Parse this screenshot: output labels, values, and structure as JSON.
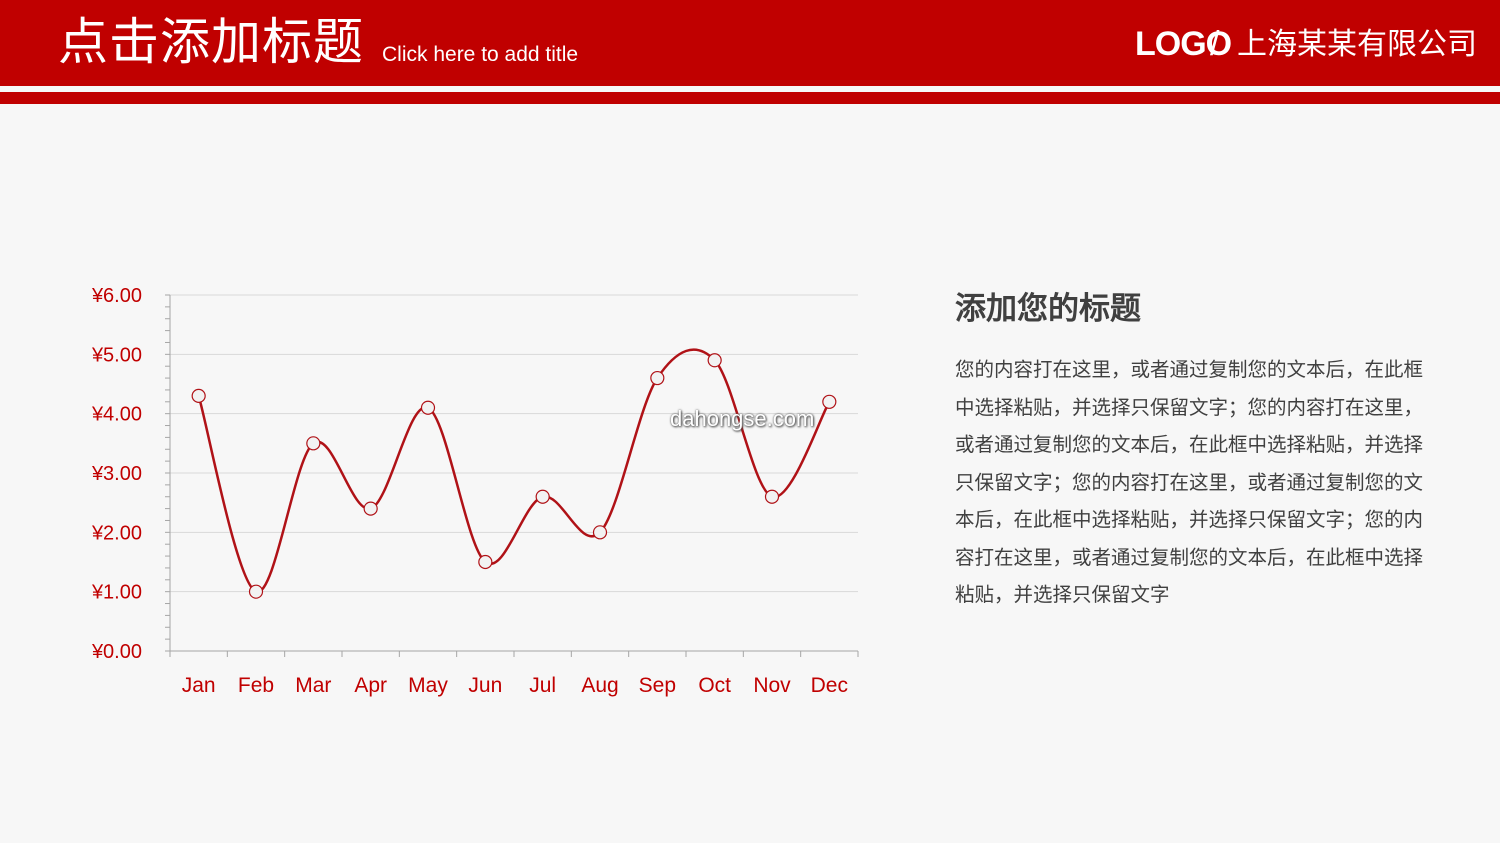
{
  "header": {
    "title": "点击添加标题",
    "subtitle": "Click here to add title",
    "logo": "LOGO",
    "separator": "/",
    "company": "上海某某有限公司"
  },
  "watermark": "dahongse.com",
  "side": {
    "heading": "添加您的标题",
    "body": "您的内容打在这里，或者通过复制您的文本后，在此框中选择粘贴，并选择只保留文字；您的内容打在这里，或者通过复制您的文本后，在此框中选择粘贴，并选择只保留文字；您的内容打在这里，或者通过复制您的文本后，在此框中选择粘贴，并选择只保留文字；您的内容打在这里，或者通过复制您的文本后，在此框中选择粘贴，并选择只保留文字"
  },
  "colors": {
    "brand": "#c00000",
    "line": "#b01217",
    "axis_text": "#c00000",
    "grid": "#d9d9d9",
    "marker_fill": "#f2f2f2"
  },
  "chart_data": {
    "type": "line",
    "categories": [
      "Jan",
      "Feb",
      "Mar",
      "Apr",
      "May",
      "Jun",
      "Jul",
      "Aug",
      "Sep",
      "Oct",
      "Nov",
      "Dec"
    ],
    "series": [
      {
        "values": [
          4.3,
          1.0,
          3.5,
          2.4,
          4.1,
          1.5,
          2.6,
          2.0,
          4.6,
          4.9,
          2.6,
          4.2
        ]
      }
    ],
    "ylim": [
      0,
      6
    ],
    "yticks": [
      0,
      1,
      2,
      3,
      4,
      5,
      6
    ],
    "ytick_labels": [
      "¥0.00",
      "¥1.00",
      "¥2.00",
      "¥3.00",
      "¥4.00",
      "¥5.00",
      "¥6.00"
    ],
    "smooth": true,
    "markers": "circle",
    "grid": true,
    "legend": "none"
  }
}
